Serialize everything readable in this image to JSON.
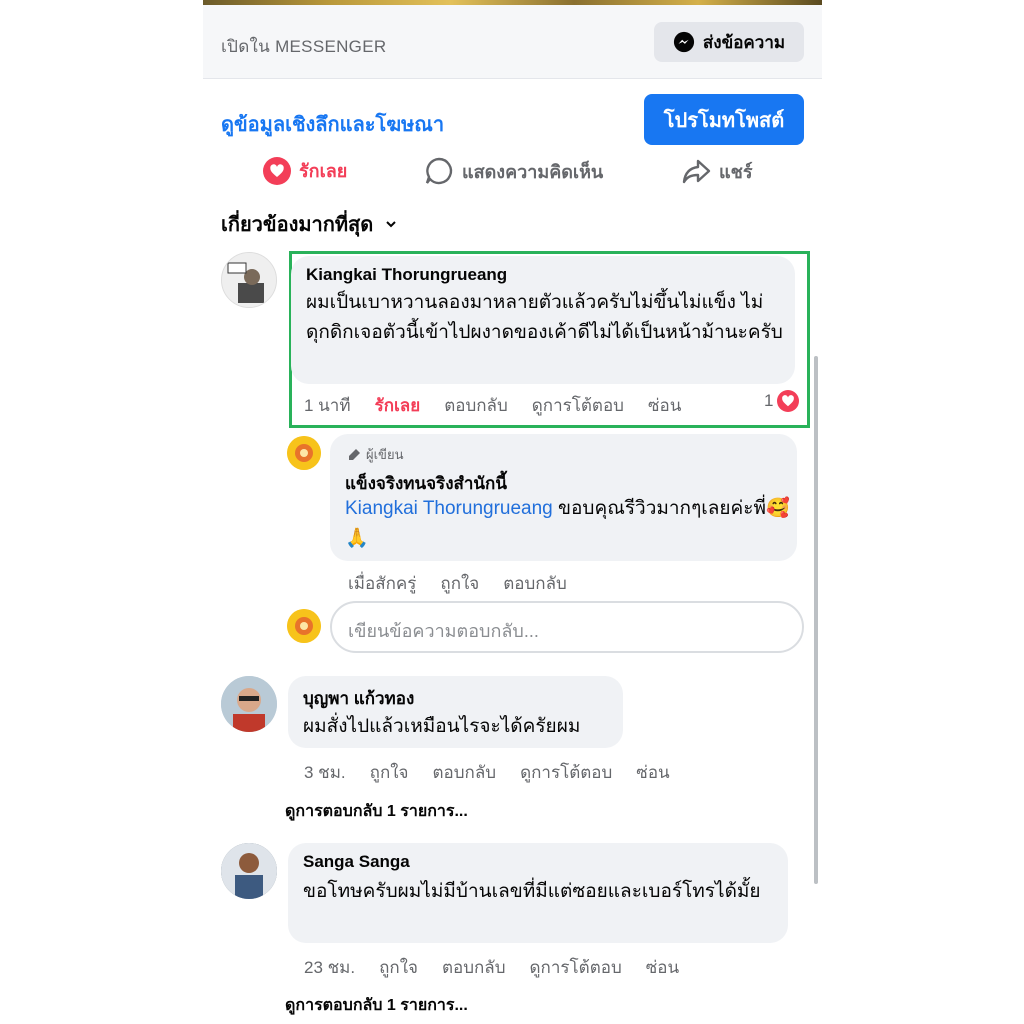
{
  "header": {
    "open_in_messenger": "เปิดใน MESSENGER",
    "send_message": "ส่งข้อความ"
  },
  "post_actions": {
    "insights": "ดูข้อมูลเชิงลึกและโฆษณา",
    "promote": "โปรโมทโพสต์",
    "love": "รักเลย",
    "comment": "แสดงความคิดเห็น",
    "share": "แชร์"
  },
  "sort": {
    "label": "เกี่ยวข้องมากที่สุด"
  },
  "comments": [
    {
      "author": "Kiangkai Thorungrueang",
      "text": "ผมเป็นเบาหวานลองมาหลายตัวแล้วครับไม่ขึ้นไม่แข็ง ไม่ดุกดิกเจอตัวนี้เข้าไปผงาดของเค้าดีไม่ได้เป็นหน้าม้านะครับ",
      "time": "1 นาที",
      "love": "รักเลย",
      "reply": "ตอบกลับ",
      "view_interactions": "ดูการโต้ตอบ",
      "hide": "ซ่อน",
      "reaction_count": "1"
    },
    {
      "author": "บุญพา แก้วทอง",
      "text": "ผมสั่งไปแล้วเหมือนไรจะได้ครัยผม",
      "time": "3 ชม.",
      "like": "ถูกใจ",
      "reply": "ตอบกลับ",
      "view_interactions": "ดูการโต้ตอบ",
      "hide": "ซ่อน",
      "view_replies": "ดูการตอบกลับ 1 รายการ..."
    },
    {
      "author": "Sanga Sanga",
      "text": "ขอโทษครับผมไม่มีบ้านเลขที่มีแต่ซอยและเบอร์โทรได้มั้ย",
      "time": "23 ชม.",
      "like": "ถูกใจ",
      "reply": "ตอบกลับ",
      "view_interactions": "ดูการโต้ตอบ",
      "hide": "ซ่อน",
      "view_replies": "ดูการตอบกลับ 1 รายการ..."
    }
  ],
  "page_reply": {
    "author_tag": "ผู้เขียน",
    "author": "แข็งจริงทนจริงสำนักนี้",
    "mention": "Kiangkai Thorungrueang",
    "text": " ขอบคุณรีวิวมากๆเลยค่ะพี่🥰🙏",
    "time": "เมื่อสักครู่",
    "like": "ถูกใจ",
    "reply": "ตอบกลับ"
  },
  "reply_box": {
    "placeholder": "เขียนข้อความตอบกลับ..."
  },
  "colors": {
    "accent_blue": "#1877f2",
    "love_red": "#f33e58",
    "highlight_green": "#29b25a"
  }
}
